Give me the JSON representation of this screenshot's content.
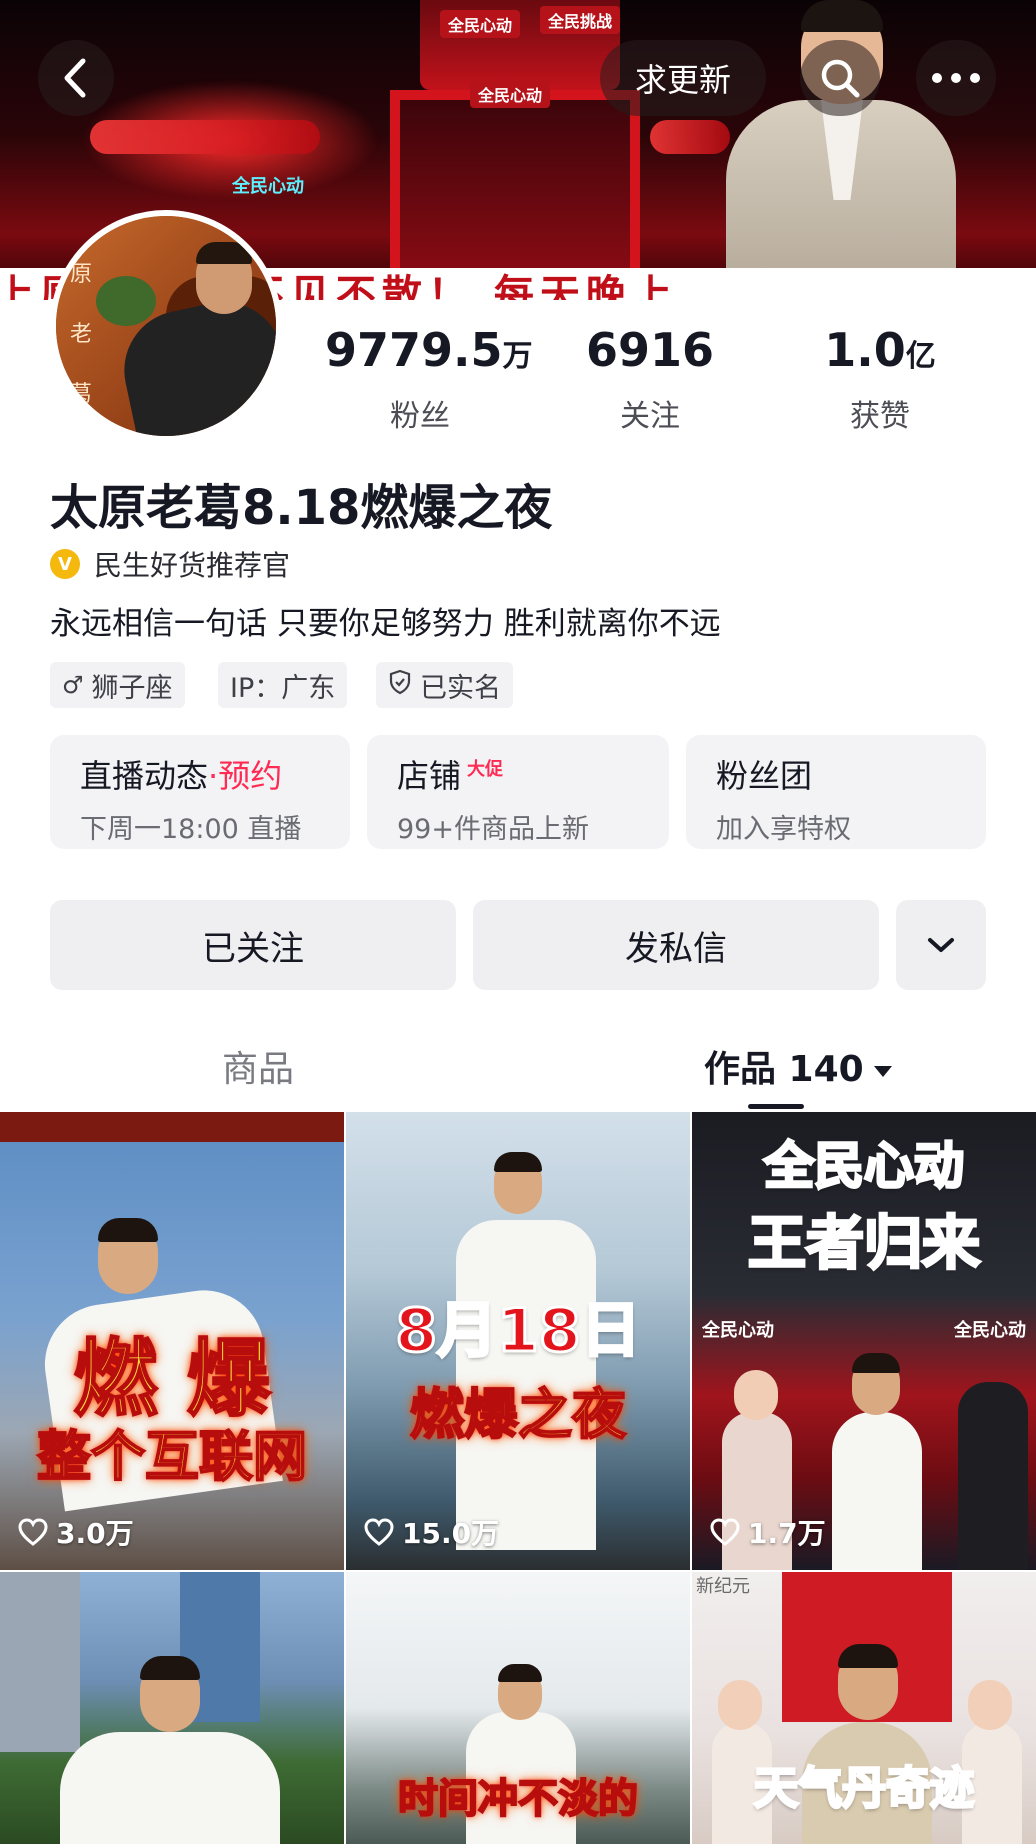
{
  "header": {
    "update_label": "求更新",
    "banner_signs": [
      "全民心动",
      "全民挑战",
      "全民心动"
    ],
    "neon_text": "全民心动",
    "strip_text": "上原 心动》不见不散！ 每天晚上"
  },
  "avatar": {
    "text_left": [
      "原",
      "老",
      "葛"
    ]
  },
  "stats": [
    {
      "value": "9779.5",
      "unit": "万",
      "label": "粉丝"
    },
    {
      "value": "6916",
      "unit": "",
      "label": "关注"
    },
    {
      "value": "1.0",
      "unit": "亿",
      "label": "获赞"
    }
  ],
  "profile": {
    "name": "太原老葛8.18燃爆之夜",
    "verify_badge": "V",
    "verify_text": "民生好货推荐官",
    "bio": "永远相信一句话 只要你足够努力 胜利就离你不远"
  },
  "tags": [
    {
      "icon": "male-icon",
      "label": "狮子座"
    },
    {
      "icon": "",
      "label": "IP：广东"
    },
    {
      "icon": "shield-check-icon",
      "label": "已实名"
    }
  ],
  "cards": [
    {
      "title": "直播动态",
      "title_extra": "·预约",
      "subtitle": "下周一18:00 直播"
    },
    {
      "title": "店铺",
      "badge": "大促",
      "subtitle": "99+件商品上新"
    },
    {
      "title": "粉丝团",
      "subtitle": "加入享特权"
    }
  ],
  "actions": {
    "follow": "已关注",
    "message": "发私信"
  },
  "tabs": {
    "products": "商品",
    "works": "作品 140"
  },
  "videos": [
    {
      "caption1": "燃  爆",
      "caption2": "整个互联网",
      "likes": "3.0万"
    },
    {
      "caption1": "8月18日",
      "caption2": "燃爆之夜",
      "likes": "15.0万"
    },
    {
      "caption1": "全民心动",
      "caption2": "王者归来",
      "sign_left": "全民心动",
      "sign_right": "全民心动",
      "likes": "1.7万"
    },
    {
      "caption1": "",
      "caption2": "",
      "likes": ""
    },
    {
      "caption1": "时间冲不淡的",
      "caption2": "",
      "likes": ""
    },
    {
      "caption1": "天气丹奇迹",
      "caption2": "",
      "corner_text": "新纪元",
      "likes": ""
    }
  ],
  "colors": {
    "accent": "#fe2c55",
    "verify": "#f5b80c",
    "text": "#161823"
  }
}
